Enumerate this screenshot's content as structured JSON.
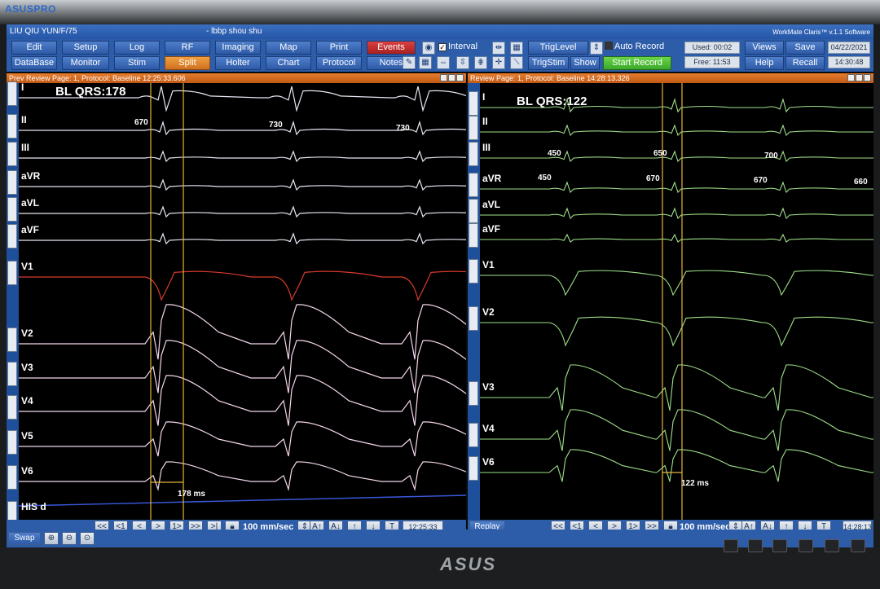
{
  "monitor": {
    "brand_top": "ASUSPRO",
    "brand_bottom": "ASUS"
  },
  "window": {
    "patient": "LIU QIU YUN/F/75",
    "study": "- lbbp  shou shu",
    "software": "WorkMate Claris™ v.1.1 Software"
  },
  "toolbar": {
    "row1": [
      "Edit",
      "Setup",
      "Log",
      "RF",
      "Imaging",
      "Map",
      "Print",
      "Events"
    ],
    "row2": [
      "DataBase",
      "Monitor",
      "Stim",
      "Split",
      "Holter",
      "Chart",
      "Protocol",
      "Notes"
    ],
    "interval_label": "Interval",
    "interval_checked": "✓",
    "triglevel": "TrigLevel",
    "auto_record": "Auto Record",
    "trigstim": "TrigStim",
    "show": "Show",
    "start_record": "Start Record",
    "used": "Used: 00:02",
    "free": "Free: 11:53",
    "views": "Views",
    "save": "Save",
    "help": "Help",
    "recall": "Recall",
    "date": "04/22/2021",
    "time": "14:30:48"
  },
  "left_pane": {
    "header": "Prev Review Page: 1, Protocol: Baseline   12:25:33.606",
    "title": "BL QRS:178",
    "leads": [
      "I",
      "II",
      "III",
      "aVR",
      "aVL",
      "aVF",
      "V1",
      "V2",
      "V3",
      "V4",
      "V5",
      "V6",
      "HIS d"
    ],
    "intervals": [
      "670",
      "730",
      "730"
    ],
    "qrs_measure": "178 ms",
    "speed": "100 mm/sec",
    "timestamp": "12:25:33",
    "swap": "Swap",
    "nav": [
      "<<",
      "<1",
      "<",
      ">",
      "1>",
      ">>",
      ">|"
    ],
    "buttons": [
      "A↑",
      "A↓",
      "↑",
      "↓",
      "T"
    ]
  },
  "right_pane": {
    "header": "Review Page: 1, Protocol: Baseline   14:28:13.326",
    "title": "BL QRS:122",
    "leads": [
      "I",
      "II",
      "III",
      "aVR",
      "aVL",
      "aVF",
      "V1",
      "V2",
      "V3",
      "V4",
      "V6"
    ],
    "intervals_ii": [
      "450",
      "650",
      "700"
    ],
    "intervals_iii": [
      "450",
      "670",
      "670",
      "660"
    ],
    "qrs_measure": "122 ms",
    "speed": "100 mm/sec",
    "timestamp": "14:28:13",
    "replay": "Replay",
    "nav": [
      "<<",
      "<1",
      "<",
      ">",
      "1>",
      ">>",
      ">|"
    ],
    "buttons": [
      "A↑",
      "A↓",
      "↑",
      "↓",
      "T"
    ]
  },
  "colors": {
    "left_limb": "#e8e6f2",
    "left_v1": "#d83a2c",
    "left_chest": "#f4d8ec",
    "right_trace": "#9fe08a",
    "caliper": "#e6b43a",
    "his": "#3a5adf"
  }
}
